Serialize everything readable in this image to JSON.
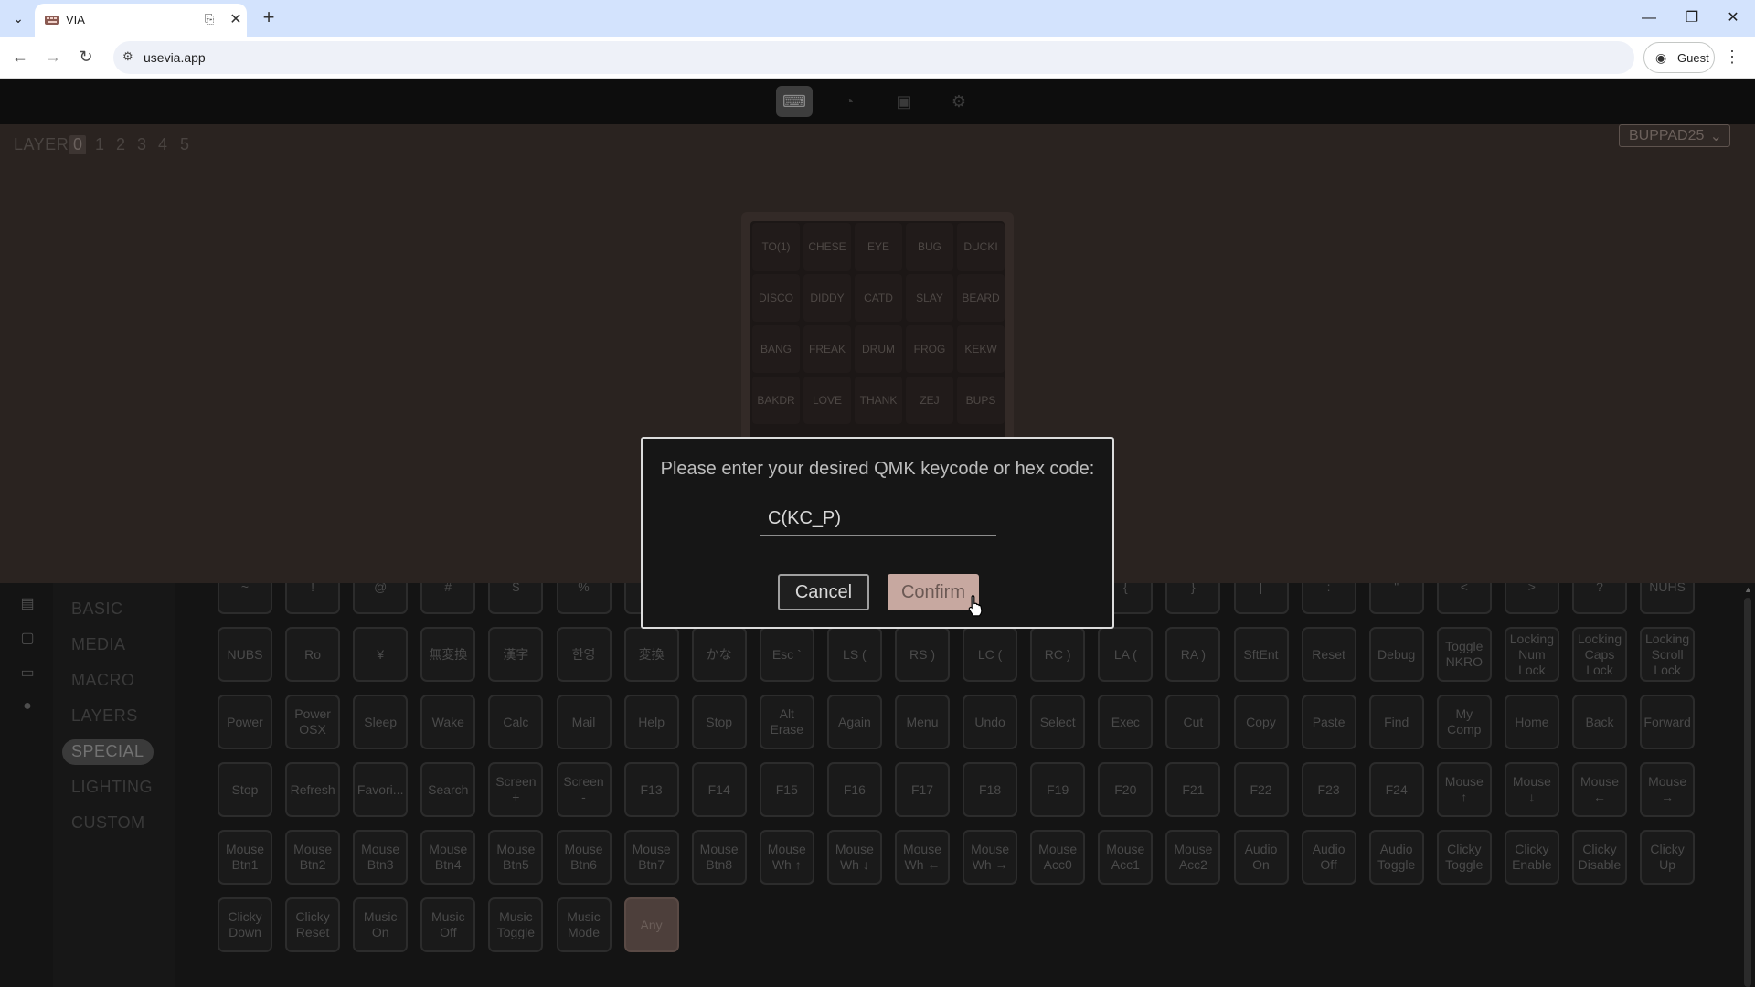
{
  "browser": {
    "tab_title": "VIA",
    "url": "usevia.app",
    "profile_label": "Guest"
  },
  "app": {
    "layer_label": "LAYER",
    "layers": [
      "0",
      "1",
      "2",
      "3",
      "4",
      "5"
    ],
    "active_layer": "0",
    "keyboard_name": "BUPPAD25",
    "keyboard_keys": [
      [
        "TO(1)",
        "CHESE",
        "EYE",
        "BUG",
        "DUCKI"
      ],
      [
        "DISCO",
        "DIDDY",
        "CATD",
        "SLAY",
        "BEARD"
      ],
      [
        "BANG",
        "FREAK",
        "DRUM",
        "FROG",
        "KEKW"
      ],
      [
        "BAKDR",
        "LOVE",
        "THANK",
        "ZEJ",
        "BUPS"
      ]
    ],
    "menu": [
      "BASIC",
      "MEDIA",
      "MACRO",
      "LAYERS",
      "SPECIAL",
      "LIGHTING",
      "CUSTOM"
    ],
    "active_menu": "SPECIAL",
    "keycode_rows": [
      [
        "~",
        "!",
        "@",
        "#",
        "$",
        "%",
        "^",
        "&",
        "*",
        "(",
        ")",
        "_",
        "+",
        "{",
        "}",
        "|",
        ":",
        "\"",
        "<",
        ">",
        "?",
        "NUHS"
      ],
      [
        "NUBS",
        "Ro",
        "¥",
        "無変換",
        "漢字",
        "한영",
        "変換",
        "かな",
        "Esc `",
        "LS (",
        "RS )",
        "LC (",
        "RC )",
        "LA (",
        "RA )",
        "SftEnt",
        "Reset",
        "Debug",
        "Toggle\nNKRO",
        "Locking\nNum\nLock",
        "Locking\nCaps\nLock",
        "Locking\nScroll\nLock"
      ],
      [
        "Power",
        "Power\nOSX",
        "Sleep",
        "Wake",
        "Calc",
        "Mail",
        "Help",
        "Stop",
        "Alt\nErase",
        "Again",
        "Menu",
        "Undo",
        "Select",
        "Exec",
        "Cut",
        "Copy",
        "Paste",
        "Find",
        "My\nComp",
        "Home",
        "Back",
        "Forward"
      ],
      [
        "Stop",
        "Refresh",
        "Favori...",
        "Search",
        "Screen\n+",
        "Screen\n-",
        "F13",
        "F14",
        "F15",
        "F16",
        "F17",
        "F18",
        "F19",
        "F20",
        "F21",
        "F22",
        "F23",
        "F24",
        "Mouse\n↑",
        "Mouse\n↓",
        "Mouse\n←",
        "Mouse\n→"
      ],
      [
        "Mouse\nBtn1",
        "Mouse\nBtn2",
        "Mouse\nBtn3",
        "Mouse\nBtn4",
        "Mouse\nBtn5",
        "Mouse\nBtn6",
        "Mouse\nBtn7",
        "Mouse\nBtn8",
        "Mouse\nWh ↑",
        "Mouse\nWh ↓",
        "Mouse\nWh ←",
        "Mouse\nWh →",
        "Mouse\nAcc0",
        "Mouse\nAcc1",
        "Mouse\nAcc2",
        "Audio\nOn",
        "Audio\nOff",
        "Audio\nToggle",
        "Clicky\nToggle",
        "Clicky\nEnable",
        "Clicky\nDisable",
        "Clicky\nUp"
      ],
      [
        "Clicky\nDown",
        "Clicky\nReset",
        "Music\nOn",
        "Music\nOff",
        "Music\nToggle",
        "Music\nMode",
        "Any"
      ]
    ],
    "selected_keycode": "Any"
  },
  "dialog": {
    "prompt": "Please enter your desired QMK keycode or hex code:",
    "input_value": "C(KC_P)",
    "cancel_label": "Cancel",
    "confirm_label": "Confirm"
  }
}
